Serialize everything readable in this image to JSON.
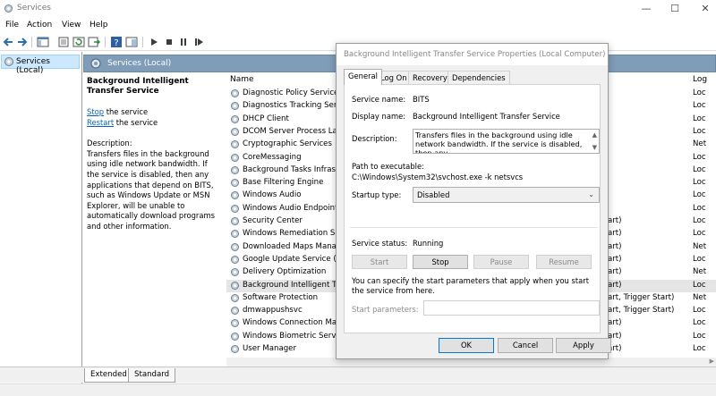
{
  "window": {
    "title": "Services",
    "controls": {
      "minimize": "—",
      "maximize": "☐",
      "close": "✕"
    }
  },
  "menu": [
    "File",
    "Action",
    "View",
    "Help"
  ],
  "toolbar": {
    "icons": [
      "back-arrow-icon",
      "forward-arrow-icon",
      "console-tree-icon",
      "properties-icon",
      "refresh-icon",
      "export-icon",
      "help-icon",
      "show-hide-icon",
      "play-icon",
      "stop-icon",
      "pause-icon",
      "restart-icon"
    ]
  },
  "tree": {
    "node_label": "Services (Local)"
  },
  "main": {
    "header": "Services (Local)",
    "description": {
      "title": "Background Intelligent Transfer Service",
      "stop_link": "Stop",
      "stop_suffix": " the service",
      "restart_link": "Restart",
      "restart_suffix": " the service",
      "label": "Description:",
      "text": "Transfers files in the background using idle network bandwidth. If the service is disabled, then any applications that depend on BITS, such as Windows Update or MSN Explorer, will be unable to automatically download programs and other information."
    },
    "columns": {
      "name": "Name",
      "logon": "Log"
    },
    "services": [
      {
        "name": "Diagnostic Policy Service",
        "startup": "",
        "logon": "Loc"
      },
      {
        "name": "Diagnostics Tracking Service",
        "startup": "",
        "logon": "Loc"
      },
      {
        "name": "DHCP Client",
        "startup": "",
        "logon": "Loc"
      },
      {
        "name": "DCOM Server Process Launcher",
        "startup": "",
        "logon": "Loc"
      },
      {
        "name": "Cryptographic Services",
        "startup": "",
        "logon": "Net"
      },
      {
        "name": "CoreMessaging",
        "startup": "",
        "logon": "Loc"
      },
      {
        "name": "Background Tasks Infrastructure",
        "startup": "",
        "logon": "Loc"
      },
      {
        "name": "Base Filtering Engine",
        "startup": "",
        "logon": "Loc"
      },
      {
        "name": "Windows Audio",
        "startup": "",
        "logon": "Loc"
      },
      {
        "name": "Windows Audio Endpoint Builder",
        "startup": "",
        "logon": "Loc"
      },
      {
        "name": "Security Center",
        "startup": "art)",
        "logon": "Loc"
      },
      {
        "name": "Windows Remediation Service",
        "startup": "art)",
        "logon": "Loc"
      },
      {
        "name": "Downloaded Maps Manager",
        "startup": "art)",
        "logon": "Net"
      },
      {
        "name": "Google Update Service (gupdate)",
        "startup": "art)",
        "logon": "Loc"
      },
      {
        "name": "Delivery Optimization",
        "startup": "art)",
        "logon": "Net"
      },
      {
        "name": "Background Intelligent Transfer Service",
        "startup": "art)",
        "logon": "Loc"
      },
      {
        "name": "Software Protection",
        "startup": "art, Trigger Start)",
        "logon": "Net"
      },
      {
        "name": "dmwappushsvc",
        "startup": "art, Trigger Start)",
        "logon": "Loc"
      },
      {
        "name": "Windows Connection Manager",
        "startup": "art)",
        "logon": "Loc"
      },
      {
        "name": "Windows Biometric Service",
        "startup": "art)",
        "logon": "Loc"
      },
      {
        "name": "User Manager",
        "startup": "art)",
        "logon": "Loc"
      }
    ],
    "selected_index": 15
  },
  "bottom_tabs": [
    "Extended",
    "Standard"
  ],
  "dialog": {
    "title": "Background Intelligent Transfer Service Properties (Local Computer)",
    "tabs": [
      "General",
      "Log On",
      "Recovery",
      "Dependencies"
    ],
    "service_name_label": "Service name:",
    "service_name": "BITS",
    "display_name_label": "Display name:",
    "display_name": "Background Intelligent Transfer Service",
    "description_label": "Description:",
    "description": "Transfers files in the background using idle network bandwidth. If the service is disabled, then any",
    "path_label": "Path to executable:",
    "path": "C:\\Windows\\System32\\svchost.exe -k netsvcs",
    "startup_type_label": "Startup type:",
    "startup_type": "Disabled",
    "status_label": "Service status:",
    "status": "Running",
    "buttons": {
      "start": "Start",
      "stop": "Stop",
      "pause": "Pause",
      "resume": "Resume"
    },
    "params_help": "You can specify the start parameters that apply when you start the service from here.",
    "params_label": "Start parameters:",
    "params_value": "",
    "ok": "OK",
    "cancel": "Cancel",
    "apply": "Apply"
  }
}
